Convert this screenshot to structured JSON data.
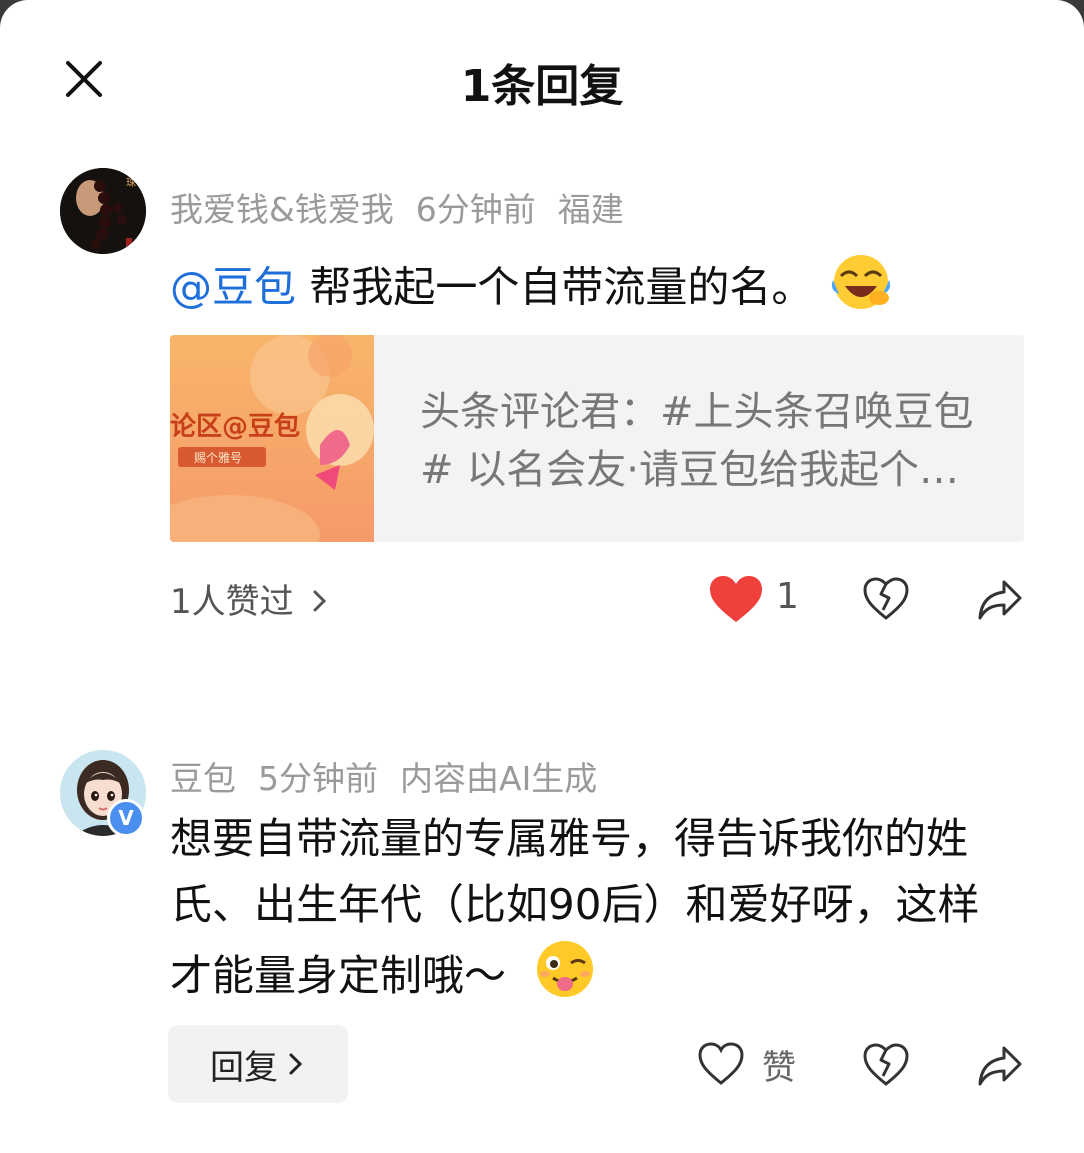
{
  "header": {
    "title": "1条回复",
    "close_icon": "close-icon"
  },
  "comment": {
    "username": "我爱钱&钱爱我",
    "time": "6分钟前",
    "location": "福建",
    "mention": "@豆包",
    "text": " 帮我起一个自带流量的名。",
    "emoji": "laughing-crying-emoji",
    "card": {
      "thumb_title": "论区@豆包",
      "thumb_badge": "赐个雅号",
      "text": "头条评论君：#上头条召唤豆包# 以名会友·请豆包给我起个雅号"
    },
    "likers": "1人赞过",
    "like_count": "1",
    "liked": true
  },
  "reply": {
    "username": "豆包",
    "time": "5分钟前",
    "ai_note": "内容由AI生成",
    "verified_badge": "V",
    "text": "想要自带流量的专属雅号，得告诉我你的姓氏、出生年代（比如90后）和爱好呀，这样才能量身定制哦～",
    "emoji": "winking-tongue-emoji",
    "reply_button": "回复",
    "like_label": "赞"
  },
  "colors": {
    "mention": "#1e6fd9",
    "like_red": "#f0403c",
    "meta_gray": "#9a9a9a"
  }
}
